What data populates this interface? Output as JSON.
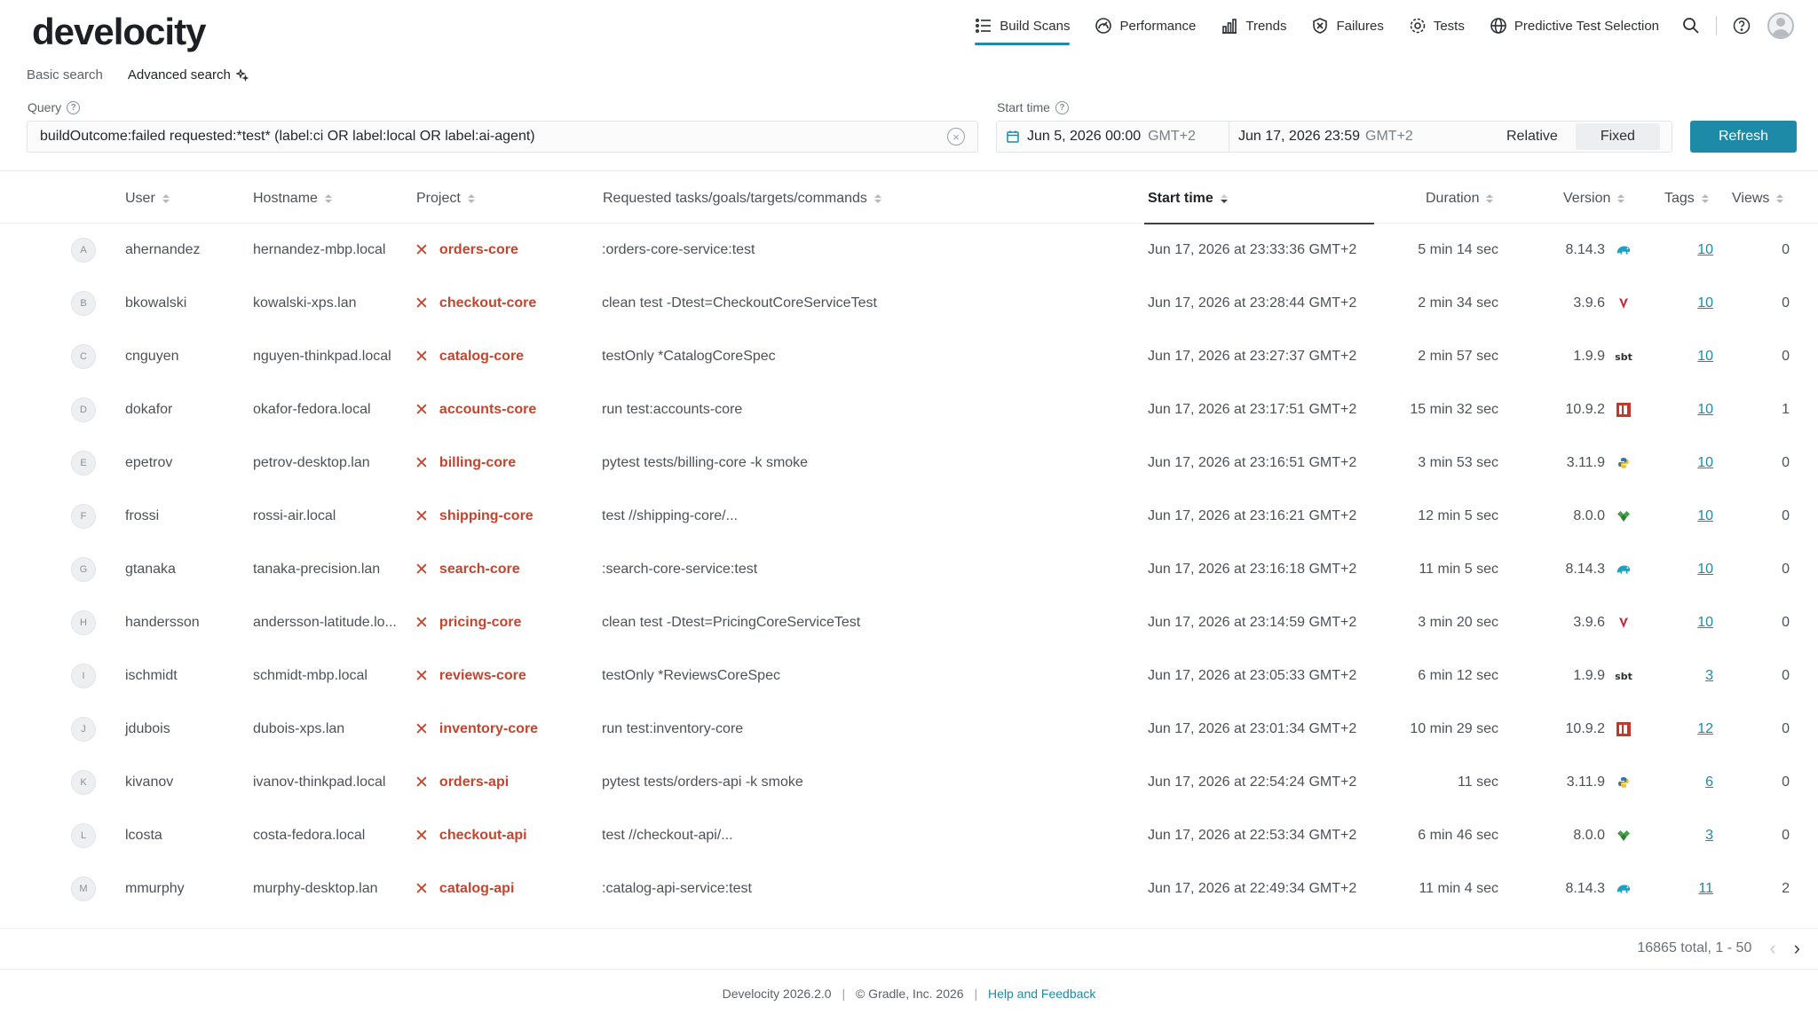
{
  "app": {
    "logo": "develocity"
  },
  "nav": {
    "items": [
      {
        "label": "Build Scans",
        "icon": "list-icon",
        "active": true
      },
      {
        "label": "Performance",
        "icon": "gauge-icon"
      },
      {
        "label": "Trends",
        "icon": "bar-chart-icon"
      },
      {
        "label": "Failures",
        "icon": "shield-icon"
      },
      {
        "label": "Tests",
        "icon": "gear-icon"
      },
      {
        "label": "Predictive Test Selection",
        "icon": "globe-icon"
      }
    ]
  },
  "search": {
    "basic_label": "Basic search",
    "advanced_label": "Advanced search",
    "query_label": "Query",
    "query_value": "buildOutcome:failed requested:*test* (label:ci OR label:local OR label:ai-agent)",
    "start_time_label": "Start time",
    "from_date": "Jun 5, 2026 00:00",
    "from_tz": "GMT+2",
    "to_date": "Jun 17, 2026 23:59",
    "to_tz": "GMT+2",
    "relative_label": "Relative",
    "fixed_label": "Fixed",
    "refresh_label": "Refresh"
  },
  "table": {
    "headers": {
      "user": "User",
      "hostname": "Hostname",
      "project": "Project",
      "requested": "Requested tasks/goals/targets/commands",
      "start": "Start time",
      "duration": "Duration",
      "version": "Version",
      "tags": "Tags",
      "views": "Views"
    },
    "rows": [
      {
        "initial": "A",
        "user": "ahernandez",
        "host": "hernandez-mbp.local",
        "project": "orders-core",
        "requested": ":orders-core-service:test",
        "start": "Jun 17, 2026 at 23:33:36 GMT+2",
        "duration": "5 min 14 sec",
        "version": "8.14.3",
        "tool": "gradle",
        "tags": "10",
        "views": "0"
      },
      {
        "initial": "B",
        "user": "bkowalski",
        "host": "kowalski-xps.lan",
        "project": "checkout-core",
        "requested": "clean test -Dtest=CheckoutCoreServiceTest",
        "start": "Jun 17, 2026 at 23:28:44 GMT+2",
        "duration": "2 min 34 sec",
        "version": "3.9.6",
        "tool": "maven",
        "tags": "10",
        "views": "0"
      },
      {
        "initial": "C",
        "user": "cnguyen",
        "host": "nguyen-thinkpad.local",
        "project": "catalog-core",
        "requested": "testOnly *CatalogCoreSpec",
        "start": "Jun 17, 2026 at 23:27:37 GMT+2",
        "duration": "2 min 57 sec",
        "version": "1.9.9",
        "tool": "sbt",
        "tags": "10",
        "views": "0"
      },
      {
        "initial": "D",
        "user": "dokafor",
        "host": "okafor-fedora.local",
        "project": "accounts-core",
        "requested": "run test:accounts-core",
        "start": "Jun 17, 2026 at 23:17:51 GMT+2",
        "duration": "15 min 32 sec",
        "version": "10.9.2",
        "tool": "bazel",
        "tags": "10",
        "views": "1"
      },
      {
        "initial": "E",
        "user": "epetrov",
        "host": "petrov-desktop.lan",
        "project": "billing-core",
        "requested": "pytest tests/billing-core -k smoke",
        "start": "Jun 17, 2026 at 23:16:51 GMT+2",
        "duration": "3 min 53 sec",
        "version": "3.11.9",
        "tool": "python",
        "tags": "10",
        "views": "0"
      },
      {
        "initial": "F",
        "user": "frossi",
        "host": "rossi-air.local",
        "project": "shipping-core",
        "requested": "test //shipping-core/...",
        "start": "Jun 17, 2026 at 23:16:21 GMT+2",
        "duration": "12 min 5 sec",
        "version": "8.0.0",
        "tool": "bazel-green",
        "tags": "10",
        "views": "0"
      },
      {
        "initial": "G",
        "user": "gtanaka",
        "host": "tanaka-precision.lan",
        "project": "search-core",
        "requested": ":search-core-service:test",
        "start": "Jun 17, 2026 at 23:16:18 GMT+2",
        "duration": "11 min 5 sec",
        "version": "8.14.3",
        "tool": "gradle",
        "tags": "10",
        "views": "0"
      },
      {
        "initial": "H",
        "user": "handersson",
        "host": "andersson-latitude.lo...",
        "project": "pricing-core",
        "requested": "clean test -Dtest=PricingCoreServiceTest",
        "start": "Jun 17, 2026 at 23:14:59 GMT+2",
        "duration": "3 min 20 sec",
        "version": "3.9.6",
        "tool": "maven",
        "tags": "10",
        "views": "0"
      },
      {
        "initial": "I",
        "user": "ischmidt",
        "host": "schmidt-mbp.local",
        "project": "reviews-core",
        "requested": "testOnly *ReviewsCoreSpec",
        "start": "Jun 17, 2026 at 23:05:33 GMT+2",
        "duration": "6 min 12 sec",
        "version": "1.9.9",
        "tool": "sbt",
        "tags": "3",
        "views": "0"
      },
      {
        "initial": "J",
        "user": "jdubois",
        "host": "dubois-xps.lan",
        "project": "inventory-core",
        "requested": "run test:inventory-core",
        "start": "Jun 17, 2026 at 23:01:34 GMT+2",
        "duration": "10 min 29 sec",
        "version": "10.9.2",
        "tool": "bazel",
        "tags": "12",
        "views": "0"
      },
      {
        "initial": "K",
        "user": "kivanov",
        "host": "ivanov-thinkpad.local",
        "project": "orders-api",
        "requested": "pytest tests/orders-api -k smoke",
        "start": "Jun 17, 2026 at 22:54:24 GMT+2",
        "duration": "11 sec",
        "version": "3.11.9",
        "tool": "python",
        "tags": "6",
        "views": "0"
      },
      {
        "initial": "L",
        "user": "lcosta",
        "host": "costa-fedora.local",
        "project": "checkout-api",
        "requested": "test //checkout-api/...",
        "start": "Jun 17, 2026 at 22:53:34 GMT+2",
        "duration": "6 min 46 sec",
        "version": "8.0.0",
        "tool": "bazel-green",
        "tags": "3",
        "views": "0"
      },
      {
        "initial": "M",
        "user": "mmurphy",
        "host": "murphy-desktop.lan",
        "project": "catalog-api",
        "requested": ":catalog-api-service:test",
        "start": "Jun 17, 2026 at 22:49:34 GMT+2",
        "duration": "11 min 4 sec",
        "version": "8.14.3",
        "tool": "gradle",
        "tags": "11",
        "views": "2"
      }
    ]
  },
  "pager": {
    "summary": "16865 total, 1 - 50"
  },
  "footer": {
    "version": "Develocity 2026.2.0",
    "copyright": "© Gradle, Inc. 2026",
    "help": "Help and Feedback"
  },
  "colors": {
    "accent": "#1d8aa8",
    "failed": "#c2452f"
  }
}
